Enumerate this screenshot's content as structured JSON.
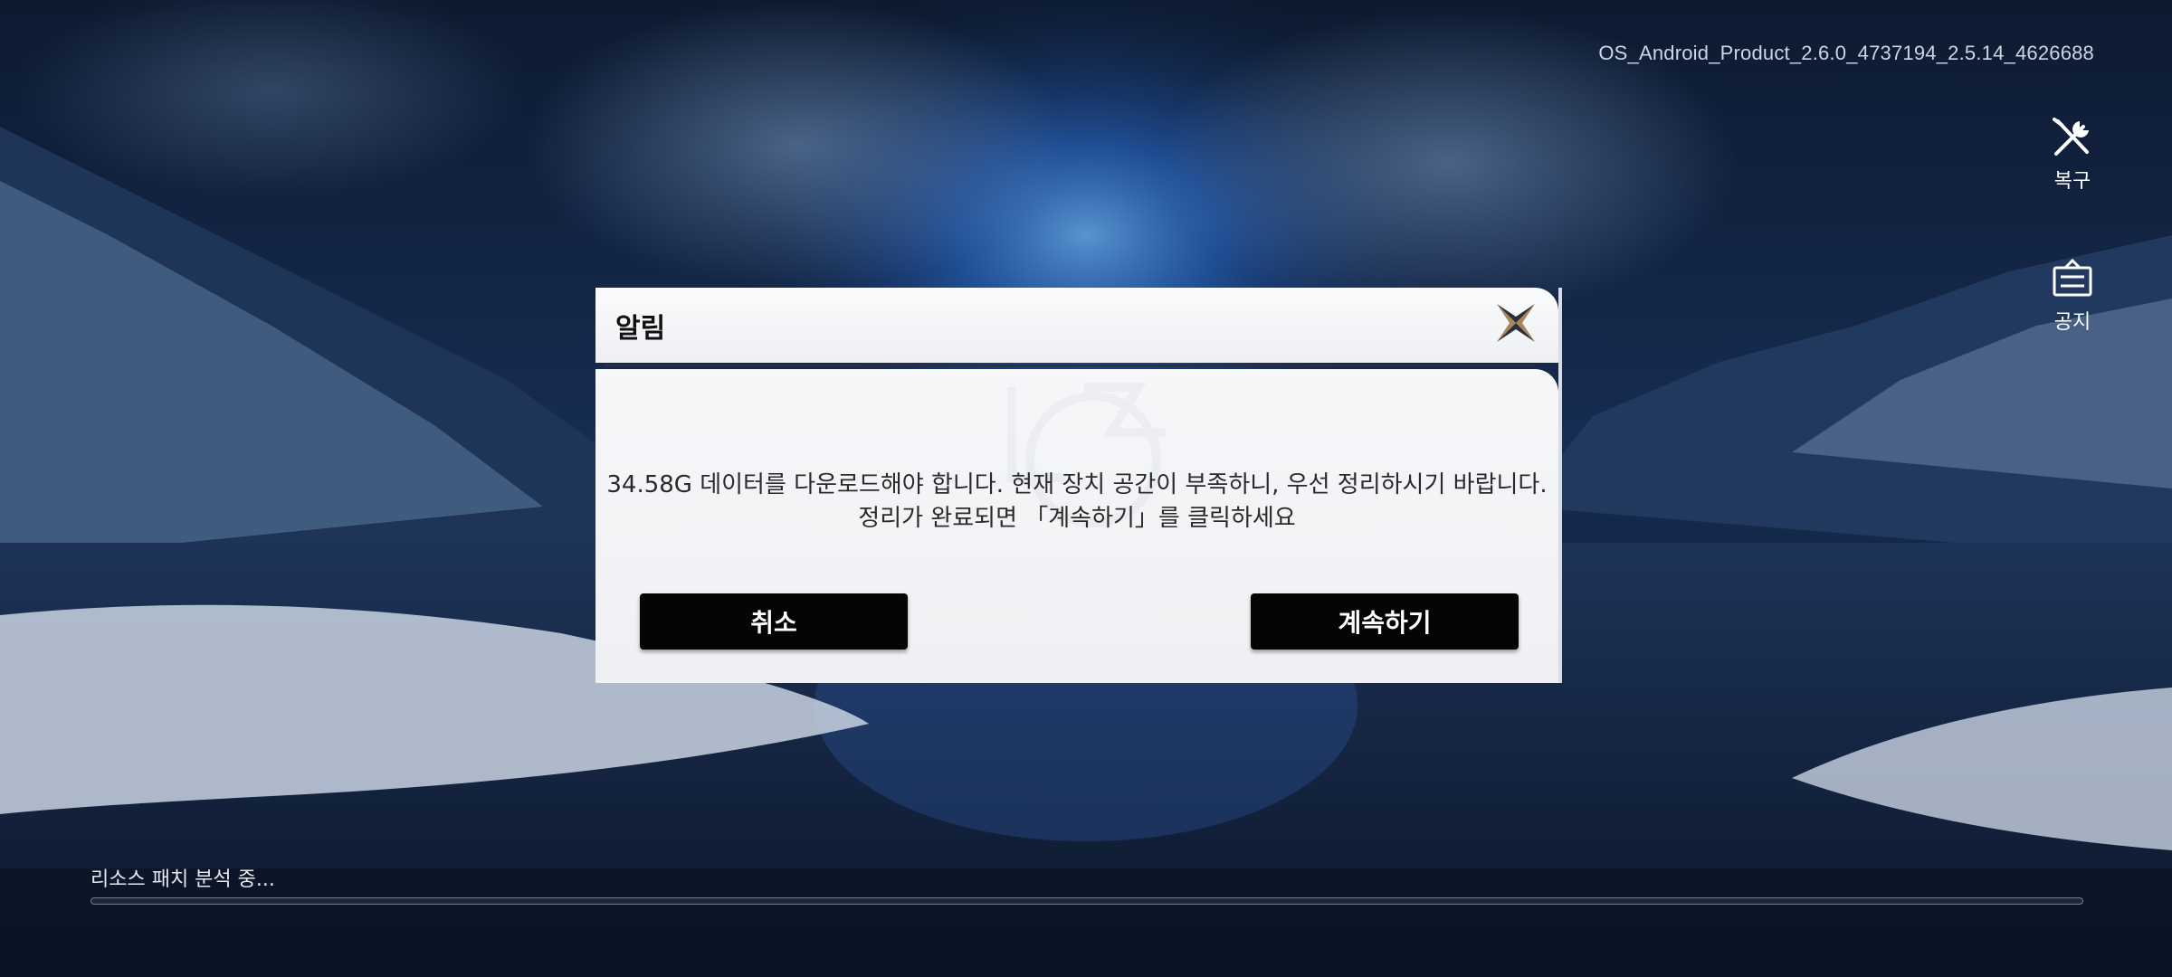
{
  "version_text": "OS_Android_Product_2.6.0_4737194_2.5.14_4626688",
  "side_buttons": {
    "repair_label": "복구",
    "notice_label": "공지"
  },
  "dialog": {
    "title": "알림",
    "message_line1": "34.58G 데이터를 다운로드해야 합니다. 현재 장치 공간이 부족하니, 우선 정리하시기 바랍니다.",
    "message_line2": "정리가 완료되면 「계속하기」를 클릭하세요",
    "cancel_label": "취소",
    "continue_label": "계속하기"
  },
  "status": {
    "text": "리소스 패치 분석 중...",
    "progress": 0
  },
  "colors": {
    "accent_gold": "#a8865a",
    "button_bg": "#050505",
    "dialog_bg": "#f4f5f7"
  }
}
